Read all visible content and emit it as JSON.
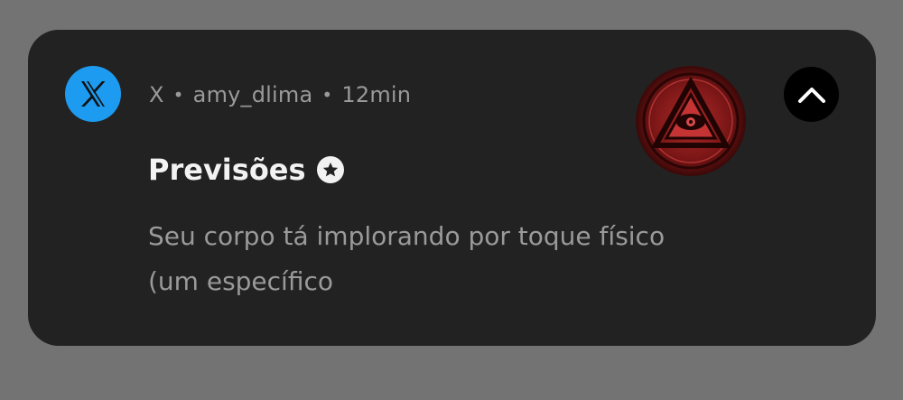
{
  "notification": {
    "app_name": "X",
    "separator": "•",
    "account": "amy_dlima",
    "time": "12min",
    "title": "Previsões",
    "body_line1": "Seu corpo tá implorando por toque físico",
    "body_line2": "(um específico",
    "icons": {
      "app": "x-logo-icon",
      "badge": "star-badge-icon",
      "thumbnail": "all-seeing-eye-thumbnail",
      "collapse": "chevron-up-icon"
    },
    "colors": {
      "background": "#737373",
      "card": "#222222",
      "app_icon": "#1d9bf0",
      "thumbnail": "#8b1a1a",
      "collapse_button": "#000000"
    }
  }
}
